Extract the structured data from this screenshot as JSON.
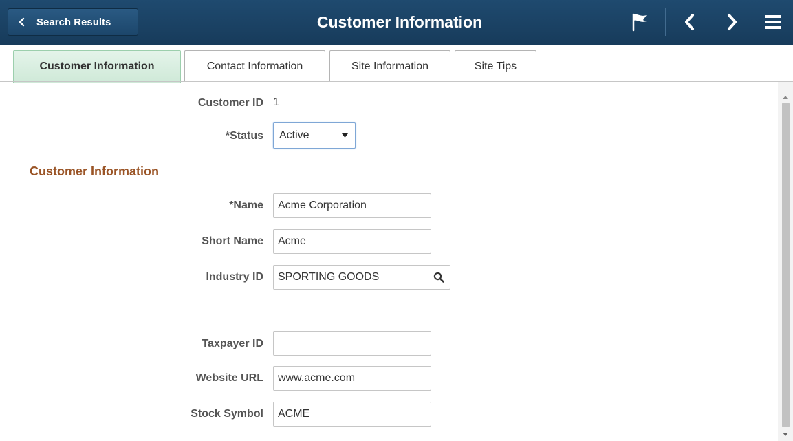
{
  "header": {
    "back_label": "Search Results",
    "title": "Customer Information",
    "icons": [
      "chevron-left-icon",
      "flag-icon",
      "previous-icon",
      "next-icon",
      "menu-icon"
    ]
  },
  "tabs": [
    {
      "label": "Customer Information",
      "active": true
    },
    {
      "label": "Contact Information",
      "active": false
    },
    {
      "label": "Site Information",
      "active": false
    },
    {
      "label": "Site Tips",
      "active": false
    }
  ],
  "form": {
    "customer_id": {
      "label": "Customer ID",
      "value": "1"
    },
    "status": {
      "label": "*Status",
      "value": "Active"
    },
    "section_title": "Customer Information",
    "name": {
      "label": "*Name",
      "value": "Acme Corporation"
    },
    "short_name": {
      "label": "Short Name",
      "value": "Acme"
    },
    "industry_id": {
      "label": "Industry ID",
      "value": "SPORTING GOODS"
    },
    "taxpayer_id": {
      "label": "Taxpayer ID",
      "value": ""
    },
    "website_url": {
      "label": "Website URL",
      "value": "www.acme.com"
    },
    "stock_symbol": {
      "label": "Stock Symbol",
      "value": "ACME"
    }
  },
  "colors": {
    "header_bg": "#1f4a6f",
    "active_tab_bg": "#d6eedf",
    "section_title": "#9a5426"
  }
}
